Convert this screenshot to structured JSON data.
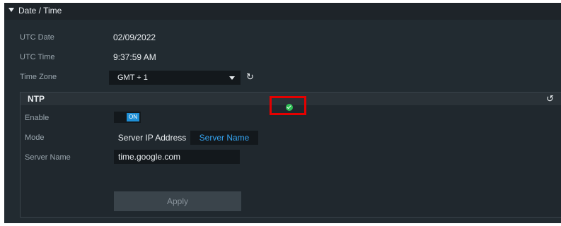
{
  "panel": {
    "title": "Date / Time"
  },
  "fields": {
    "utc_date": {
      "label": "UTC Date",
      "value": "02/09/2022"
    },
    "utc_time": {
      "label": "UTC Time",
      "value": "9:37:59 AM"
    },
    "time_zone": {
      "label": "Time Zone",
      "value": "GMT + 1"
    }
  },
  "ntp": {
    "title": "NTP",
    "enable": {
      "label": "Enable",
      "state": "ON"
    },
    "mode": {
      "label": "Mode",
      "options": [
        "Server IP Address",
        "Server Name"
      ],
      "selected": "Server Name"
    },
    "server_name": {
      "label": "Server Name",
      "value": "time.google.com"
    },
    "apply_label": "Apply"
  },
  "icons": {
    "refresh": "refresh-icon",
    "reset": "reset-icon",
    "status_ok": "check-circle-icon"
  },
  "colors": {
    "accent": "#1e8fd6",
    "link": "#35a4f0",
    "success": "#2fbf55",
    "highlight": "#e50000"
  }
}
